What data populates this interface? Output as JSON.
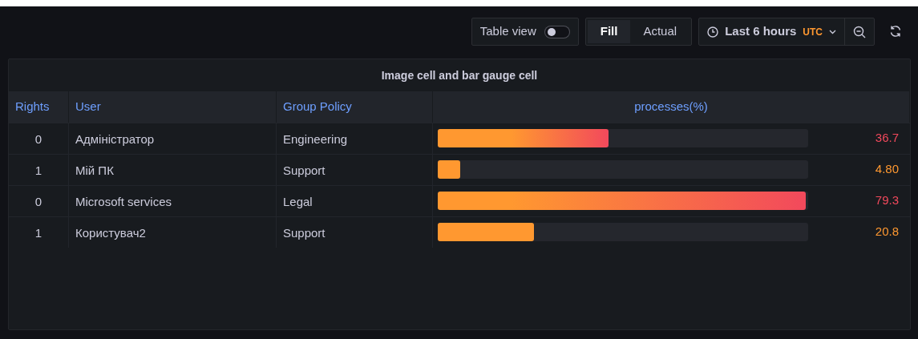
{
  "toolbar": {
    "table_view": {
      "label": "Table view",
      "on": false
    },
    "modes": [
      {
        "label": "Fill",
        "selected": true
      },
      {
        "label": "Actual",
        "selected": false
      }
    ],
    "time_range": {
      "label": "Last 6 hours",
      "timezone": "UTC"
    }
  },
  "panel": {
    "title": "Image cell and bar gauge cell",
    "table": {
      "columns": [
        "Rights",
        "User",
        "Group Policy",
        "processes(%)"
      ],
      "rows": [
        {
          "rights": "0",
          "user": "Адміністратор",
          "group_policy": "Engineering",
          "level": 0.463,
          "reading": "36.7",
          "color": "#f2495c"
        },
        {
          "rights": "1",
          "user": "Мій ПК",
          "group_policy": "Support",
          "level": 0.061,
          "reading": "4.80",
          "color": "#ff9830"
        },
        {
          "rights": "0",
          "user": "Microsoft services",
          "group_policy": "Legal",
          "level": 1.0,
          "reading": "79.3",
          "color": "#f2495c"
        },
        {
          "rights": "1",
          "user": "Користувач2",
          "group_policy": "Support",
          "level": 0.262,
          "reading": "20.8",
          "color": "#ff9830"
        }
      ]
    }
  }
}
